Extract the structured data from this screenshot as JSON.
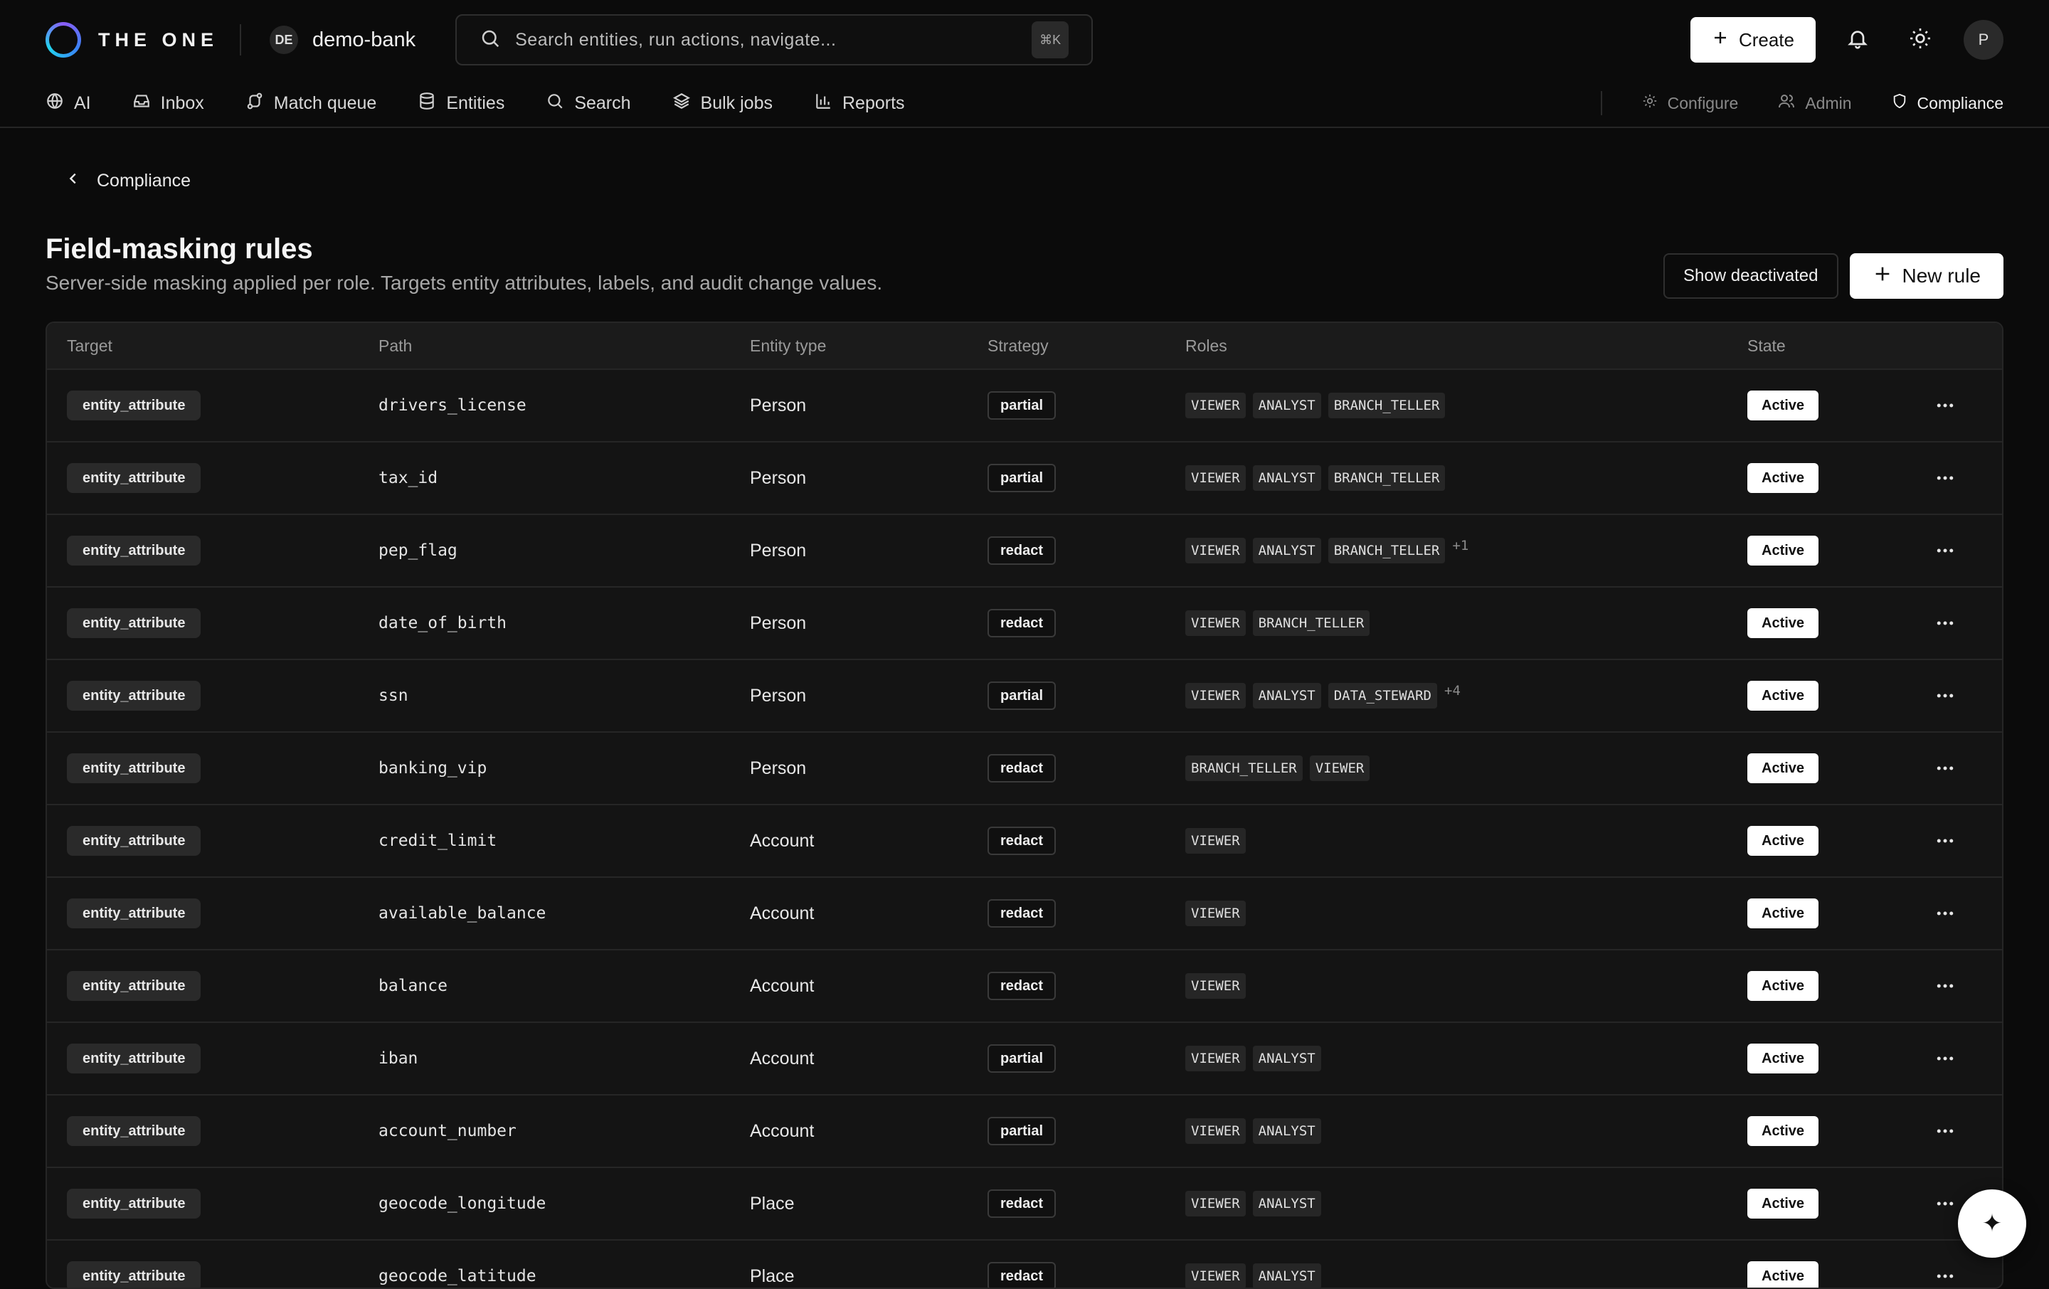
{
  "app": {
    "brand": "THE ONE",
    "workspace_initials": "DE",
    "workspace_name": "demo-bank"
  },
  "search": {
    "placeholder": "Search entities, run actions, navigate...",
    "shortcut": "⌘K"
  },
  "topbar": {
    "create_label": "Create",
    "avatar_initial": "P"
  },
  "nav": {
    "items": [
      {
        "label": "AI",
        "icon": "globe-icon"
      },
      {
        "label": "Inbox",
        "icon": "inbox-icon"
      },
      {
        "label": "Match queue",
        "icon": "route-icon"
      },
      {
        "label": "Entities",
        "icon": "database-icon"
      },
      {
        "label": "Search",
        "icon": "search-icon"
      },
      {
        "label": "Bulk jobs",
        "icon": "layers-icon"
      },
      {
        "label": "Reports",
        "icon": "bar-chart-icon"
      }
    ],
    "right_items": [
      {
        "label": "Configure",
        "icon": "gear-icon"
      },
      {
        "label": "Admin",
        "icon": "users-icon"
      },
      {
        "label": "Compliance",
        "icon": "shield-icon",
        "active": true
      }
    ]
  },
  "page": {
    "breadcrumb": "Compliance",
    "title": "Field-masking rules",
    "subtitle": "Server-side masking applied per role. Targets entity attributes, labels, and audit change values.",
    "show_deactivated_label": "Show deactivated",
    "new_rule_label": "New rule"
  },
  "table": {
    "columns": {
      "target": "Target",
      "path": "Path",
      "entity_type": "Entity type",
      "strategy": "Strategy",
      "roles": "Roles",
      "state": "State"
    },
    "rows": [
      {
        "target": "entity_attribute",
        "path": "drivers_license",
        "entity_type": "Person",
        "strategy": "partial",
        "roles": [
          "VIEWER",
          "ANALYST",
          "BRANCH_TELLER"
        ],
        "more": "",
        "state": "Active"
      },
      {
        "target": "entity_attribute",
        "path": "tax_id",
        "entity_type": "Person",
        "strategy": "partial",
        "roles": [
          "VIEWER",
          "ANALYST",
          "BRANCH_TELLER"
        ],
        "more": "",
        "state": "Active"
      },
      {
        "target": "entity_attribute",
        "path": "pep_flag",
        "entity_type": "Person",
        "strategy": "redact",
        "roles": [
          "VIEWER",
          "ANALYST",
          "BRANCH_TELLER"
        ],
        "more": "+1",
        "state": "Active"
      },
      {
        "target": "entity_attribute",
        "path": "date_of_birth",
        "entity_type": "Person",
        "strategy": "redact",
        "roles": [
          "VIEWER",
          "BRANCH_TELLER"
        ],
        "more": "",
        "state": "Active"
      },
      {
        "target": "entity_attribute",
        "path": "ssn",
        "entity_type": "Person",
        "strategy": "partial",
        "roles": [
          "VIEWER",
          "ANALYST",
          "DATA_STEWARD"
        ],
        "more": "+4",
        "state": "Active"
      },
      {
        "target": "entity_attribute",
        "path": "banking_vip",
        "entity_type": "Person",
        "strategy": "redact",
        "roles": [
          "BRANCH_TELLER",
          "VIEWER"
        ],
        "more": "",
        "state": "Active"
      },
      {
        "target": "entity_attribute",
        "path": "credit_limit",
        "entity_type": "Account",
        "strategy": "redact",
        "roles": [
          "VIEWER"
        ],
        "more": "",
        "state": "Active"
      },
      {
        "target": "entity_attribute",
        "path": "available_balance",
        "entity_type": "Account",
        "strategy": "redact",
        "roles": [
          "VIEWER"
        ],
        "more": "",
        "state": "Active"
      },
      {
        "target": "entity_attribute",
        "path": "balance",
        "entity_type": "Account",
        "strategy": "redact",
        "roles": [
          "VIEWER"
        ],
        "more": "",
        "state": "Active"
      },
      {
        "target": "entity_attribute",
        "path": "iban",
        "entity_type": "Account",
        "strategy": "partial",
        "roles": [
          "VIEWER",
          "ANALYST"
        ],
        "more": "",
        "state": "Active"
      },
      {
        "target": "entity_attribute",
        "path": "account_number",
        "entity_type": "Account",
        "strategy": "partial",
        "roles": [
          "VIEWER",
          "ANALYST"
        ],
        "more": "",
        "state": "Active"
      },
      {
        "target": "entity_attribute",
        "path": "geocode_longitude",
        "entity_type": "Place",
        "strategy": "redact",
        "roles": [
          "VIEWER",
          "ANALYST"
        ],
        "more": "",
        "state": "Active"
      },
      {
        "target": "entity_attribute",
        "path": "geocode_latitude",
        "entity_type": "Place",
        "strategy": "redact",
        "roles": [
          "VIEWER",
          "ANALYST"
        ],
        "more": "",
        "state": "Active"
      }
    ]
  },
  "fab": {
    "icon": "sparkle-icon",
    "glyph": "✦"
  }
}
